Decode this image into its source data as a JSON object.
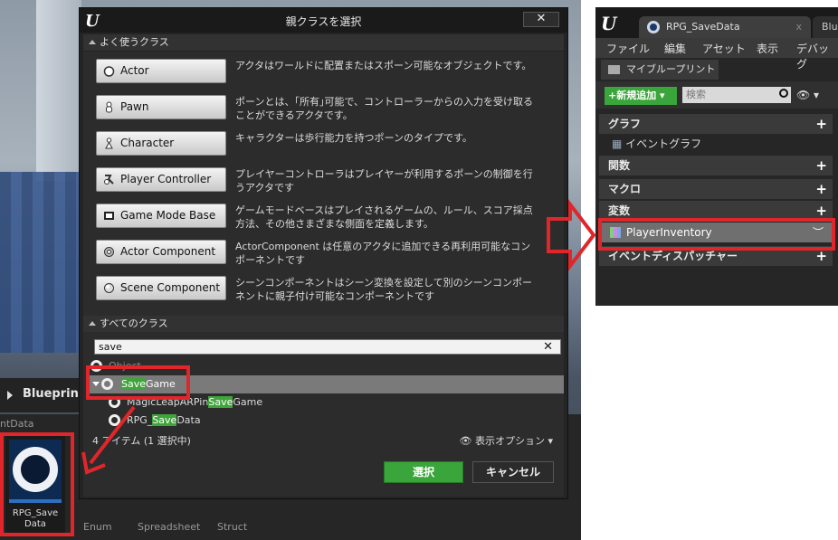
{
  "viewport": {
    "blueprint_label": "Blueprint",
    "crumb": "ntData",
    "asset_label": "RPG_Save Data",
    "bottom_labels": [
      "Enum",
      "Spreadsheet",
      "Struct"
    ]
  },
  "dialog": {
    "title": "親クラスを選択",
    "close_glyph": "✕",
    "common_header": "よく使うクラス",
    "all_header": "すべてのクラス",
    "common_classes": [
      {
        "label": "Actor",
        "desc": "アクタはワールドに配置またはスポーン可能なオブジェクトです。",
        "icon": "actor-icon"
      },
      {
        "label": "Pawn",
        "desc": "ポーンとは、｢所有｣可能で、コントローラーからの入力を受け取ることができるアクタです。",
        "icon": "pawn-icon"
      },
      {
        "label": "Character",
        "desc": "キャラクターは歩行能力を持つポーンのタイプです。",
        "icon": "character-icon"
      },
      {
        "label": "Player Controller",
        "desc": "プレイヤーコントローラはプレイヤーが利用するポーンの制御を行うアクタです",
        "icon": "player-controller-icon"
      },
      {
        "label": "Game Mode Base",
        "desc": "ゲームモードベースはプレイされるゲームの、ルール、スコア採点方法、その他さまざまな側面を定義します。",
        "icon": "game-mode-icon"
      },
      {
        "label": "Actor Component",
        "desc": "ActorComponent は任意のアクタに追加できる再利用可能なコンポーネントです",
        "icon": "actor-component-icon"
      },
      {
        "label": "Scene Component",
        "desc": "シーンコンポーネントはシーン変換を設定して別のシーンコンポーネントに親子付け可能なコンポーネントです",
        "icon": "scene-component-icon"
      }
    ],
    "search_value": "save",
    "tree": {
      "object": "Object",
      "savegame_pre": "Save",
      "savegame_post": "Game",
      "magic_pre": "MagicLeapARPin",
      "magic_hl": "Save",
      "magic_post": "Game",
      "rpg_pre": "RPG_",
      "rpg_hl": "Save",
      "rpg_post": "Data"
    },
    "item_count": "4 アイテム (1 選択中)",
    "view_options": "表示オプション",
    "select_label": "選択",
    "cancel_label": "キャンセル"
  },
  "right_panel": {
    "tab_title": "RPG_SaveData",
    "tab_close": "x",
    "tab2_title": "Blu",
    "menu": [
      "ファイル",
      "編集",
      "アセット",
      "表示",
      "デバッグ"
    ],
    "my_blueprint_tab": "マイブループリント",
    "add_new": "新規追加",
    "search_placeholder": "検索",
    "categories": {
      "graph": "グラフ",
      "event_graph": "イベントグラフ",
      "functions": "関数",
      "macros": "マクロ",
      "variables": "変数",
      "dispatchers": "イベントディスパッチャー"
    },
    "variable_name": "PlayerInventory"
  },
  "colors": {
    "accent_green": "#3aa53a",
    "highlight_green": "#3fa53b",
    "annotation_red": "#e0262a",
    "panel_dark": "#242424"
  }
}
